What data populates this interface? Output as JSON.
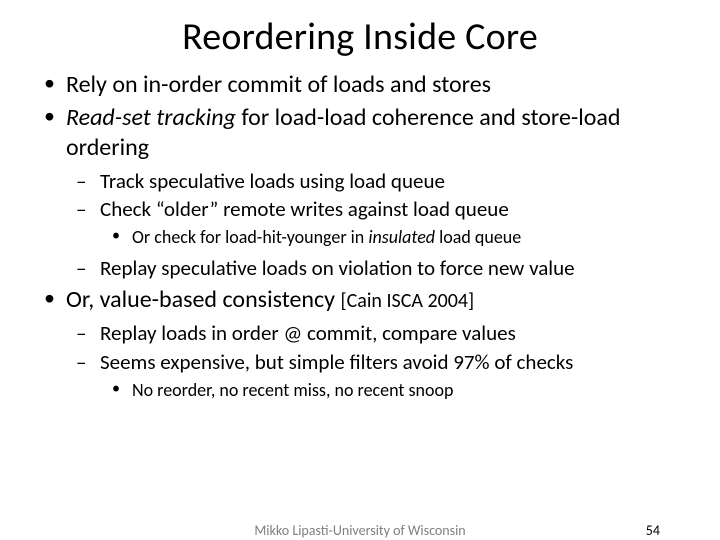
{
  "title": "Reordering Inside Core",
  "b1": {
    "a": "Rely on in-order commit of loads and stores",
    "b_em": "Read-set tracking",
    "b_rest": " for load-load coherence and store-load ordering",
    "c_pre": "Or, value-based consistency ",
    "c_cite": "[Cain ISCA 2004]"
  },
  "b2": {
    "a": "Track speculative loads using load queue",
    "b": "Check “older” remote writes against load queue",
    "c": "Replay speculative loads on violation to force new value",
    "d": "Replay loads in order @ commit, compare values",
    "e": "Seems expensive, but simple filters avoid 97% of checks"
  },
  "b3": {
    "a_pre": "Or check for load-hit-younger in ",
    "a_em": "insulated",
    "a_post": " load queue",
    "b": "No reorder, no recent miss, no recent snoop"
  },
  "footer": {
    "author": "Mikko Lipasti-University of Wisconsin",
    "page": "54"
  }
}
